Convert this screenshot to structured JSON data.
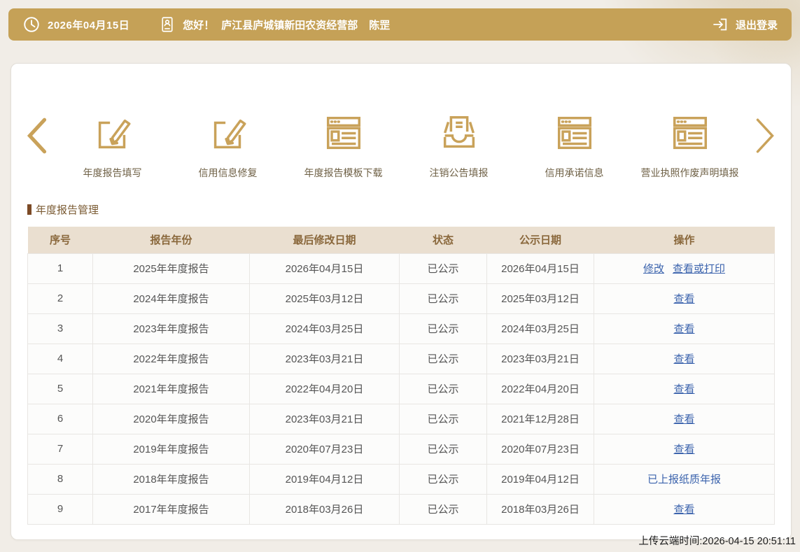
{
  "header": {
    "date": "2026年04月15日",
    "greeting": "您好！",
    "company": "庐江县庐城镇新田农资经营部",
    "user": "陈罡",
    "logout_label": "退出登录"
  },
  "carousel": {
    "prev_icon": "chevron-left",
    "next_icon": "chevron-right",
    "items": [
      {
        "label": "年度报告填写",
        "icon": "edit-square"
      },
      {
        "label": "信用信息修复",
        "icon": "edit-square"
      },
      {
        "label": "年度报告模板下载",
        "icon": "browser-doc"
      },
      {
        "label": "注销公告填报",
        "icon": "inbox-doc"
      },
      {
        "label": "信用承诺信息",
        "icon": "browser-doc"
      },
      {
        "label": "营业执照作废声明填报",
        "icon": "browser-doc"
      }
    ]
  },
  "section": {
    "title": "年度报告管理"
  },
  "table": {
    "columns": [
      "序号",
      "报告年份",
      "最后修改日期",
      "状态",
      "公示日期",
      "操作"
    ],
    "rows": [
      {
        "no": "1",
        "year": "2025年年度报告",
        "modified": "2026年04月15日",
        "status": "已公示",
        "published": "2026年04月15日",
        "actions": [
          {
            "label": "修改",
            "type": "link"
          },
          {
            "label": "查看或打印",
            "type": "link"
          }
        ]
      },
      {
        "no": "2",
        "year": "2024年年度报告",
        "modified": "2025年03月12日",
        "status": "已公示",
        "published": "2025年03月12日",
        "actions": [
          {
            "label": "查看",
            "type": "link"
          }
        ]
      },
      {
        "no": "3",
        "year": "2023年年度报告",
        "modified": "2024年03月25日",
        "status": "已公示",
        "published": "2024年03月25日",
        "actions": [
          {
            "label": "查看",
            "type": "link"
          }
        ]
      },
      {
        "no": "4",
        "year": "2022年年度报告",
        "modified": "2023年03月21日",
        "status": "已公示",
        "published": "2023年03月21日",
        "actions": [
          {
            "label": "查看",
            "type": "link"
          }
        ]
      },
      {
        "no": "5",
        "year": "2021年年度报告",
        "modified": "2022年04月20日",
        "status": "已公示",
        "published": "2022年04月20日",
        "actions": [
          {
            "label": "查看",
            "type": "link"
          }
        ]
      },
      {
        "no": "6",
        "year": "2020年年度报告",
        "modified": "2023年03月21日",
        "status": "已公示",
        "published": "2021年12月28日",
        "actions": [
          {
            "label": "查看",
            "type": "link"
          }
        ]
      },
      {
        "no": "7",
        "year": "2019年年度报告",
        "modified": "2020年07月23日",
        "status": "已公示",
        "published": "2020年07月23日",
        "actions": [
          {
            "label": "查看",
            "type": "link"
          }
        ]
      },
      {
        "no": "8",
        "year": "2018年年度报告",
        "modified": "2019年04月12日",
        "status": "已公示",
        "published": "2019年04月12日",
        "actions": [
          {
            "label": "已上报纸质年报",
            "type": "text"
          }
        ]
      },
      {
        "no": "9",
        "year": "2017年年度报告",
        "modified": "2018年03月26日",
        "status": "已公示",
        "published": "2018年03月26日",
        "actions": [
          {
            "label": "查看",
            "type": "link"
          }
        ]
      }
    ]
  },
  "footer": {
    "upload_time": "上传云端时间:2026-04-15 20:51:11"
  },
  "colors": {
    "accent_gold": "#c5a157",
    "icon_gold": "#c9a25a",
    "link_blue": "#3b63ad",
    "table_header_bg": "#eadfd0",
    "table_header_text": "#8a683c",
    "section_text": "#7a5a32",
    "page_background": "#f1ede7"
  }
}
